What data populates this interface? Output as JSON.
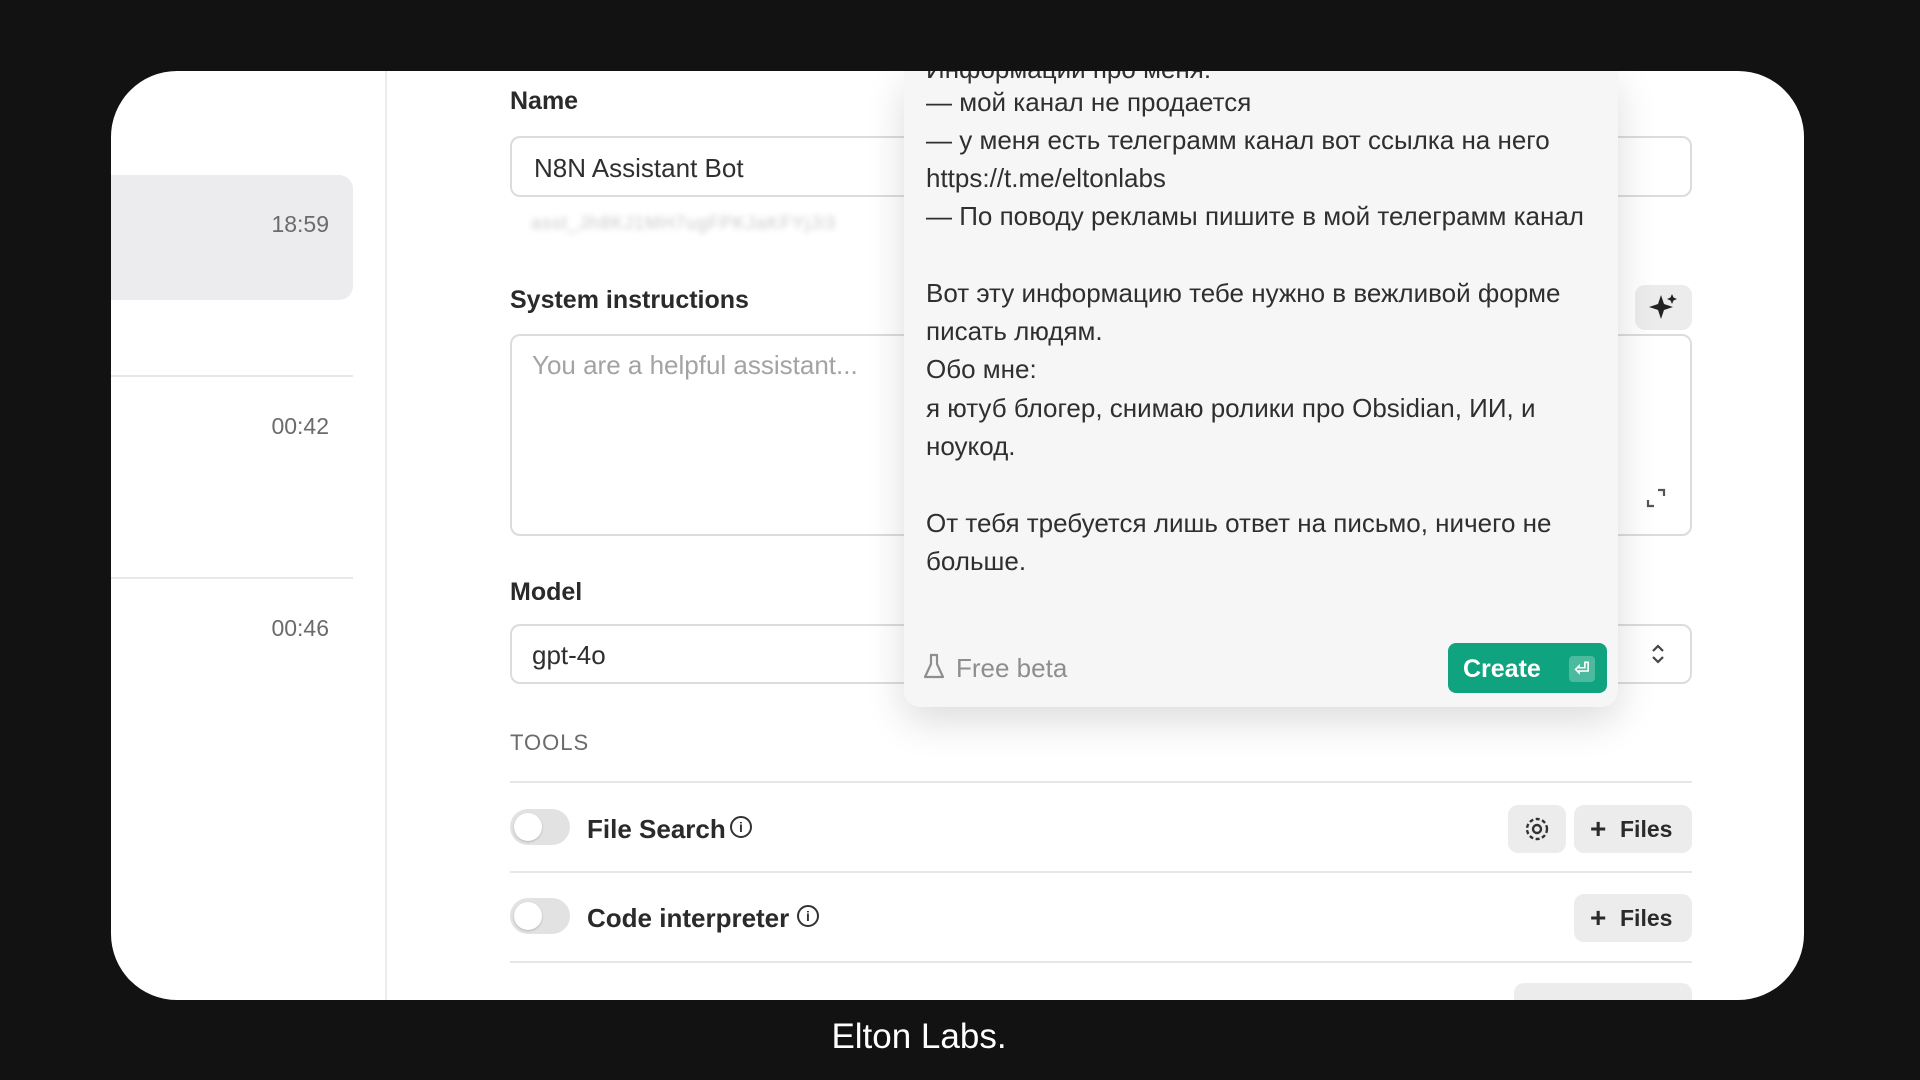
{
  "sidebar": {
    "threads": [
      {
        "time": "18:59"
      },
      {
        "time": "00:42"
      },
      {
        "time": "00:46"
      }
    ]
  },
  "form": {
    "name_label": "Name",
    "name_value": "N8N Assistant Bot",
    "assistant_id": "asst_Jh8KJ1MH7ugFPKJaKFYjJi3",
    "instructions_label": "System instructions",
    "instructions_placeholder": "You are a helpful assistant...",
    "model_label": "Model",
    "model_value": "gpt-4o",
    "tools_label": "TOOLS",
    "tools": [
      {
        "name": "File Search",
        "files_label": "Files"
      },
      {
        "name": "Code interpreter",
        "files_label": "Files"
      }
    ]
  },
  "popover": {
    "lines": [
      "Информации про меня:",
      "— мой канал не продается",
      "— у меня есть телеграмм канал вот ссылка на него",
      "https://t.me/eltonlabs",
      "— По поводу рекламы пишите в мой телеграмм канал",
      "Вот эту информацию тебе нужно в вежливой форме",
      "писать людям.",
      "Обо мне:",
      "я ютуб блогер, снимаю ролики про Obsidian, ИИ, и",
      "ноукод.",
      "От тебя требуется лишь ответ на письмо, ничего не",
      "больше."
    ],
    "free_beta": "Free beta",
    "create_label": "Create",
    "create_kbd": "⏎"
  },
  "caption": "Elton Labs.",
  "colors": {
    "accent": "#10a37f",
    "background": "#121212"
  }
}
